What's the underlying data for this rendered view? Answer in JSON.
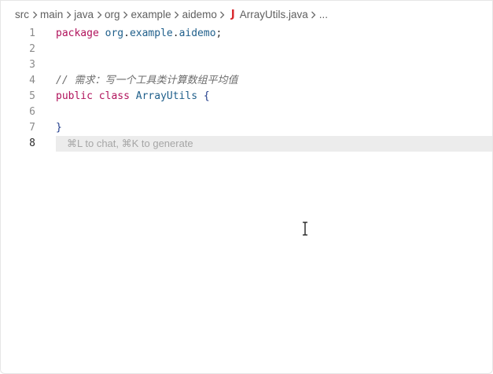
{
  "breadcrumb": {
    "items": [
      "src",
      "main",
      "java",
      "org",
      "example",
      "aidemo"
    ],
    "file_icon": "J",
    "file_name": "ArrayUtils.java",
    "more": "..."
  },
  "editor": {
    "lines": [
      {
        "number": "1",
        "parts": [
          {
            "t": "package",
            "c": "kw"
          },
          {
            "t": " ",
            "c": "punct"
          },
          {
            "t": "org",
            "c": "pkg"
          },
          {
            "t": ".",
            "c": "punct"
          },
          {
            "t": "example",
            "c": "pkg"
          },
          {
            "t": ".",
            "c": "punct"
          },
          {
            "t": "aidemo",
            "c": "pkg"
          },
          {
            "t": ";",
            "c": "punct"
          }
        ]
      },
      {
        "number": "2",
        "parts": []
      },
      {
        "number": "3",
        "parts": []
      },
      {
        "number": "4",
        "parts": [
          {
            "t": "// 需求：写一个工具类计算数组平均值",
            "c": "comment"
          }
        ]
      },
      {
        "number": "5",
        "parts": [
          {
            "t": "public",
            "c": "kw"
          },
          {
            "t": " ",
            "c": "punct"
          },
          {
            "t": "class",
            "c": "kw"
          },
          {
            "t": " ",
            "c": "punct"
          },
          {
            "t": "ArrayUtils",
            "c": "cls"
          },
          {
            "t": " ",
            "c": "punct"
          },
          {
            "t": "{",
            "c": "brace"
          }
        ]
      },
      {
        "number": "6",
        "parts": []
      },
      {
        "number": "7",
        "parts": [
          {
            "t": "}",
            "c": "brace"
          }
        ]
      },
      {
        "number": "8",
        "parts": []
      }
    ],
    "active_line": "8",
    "hint": "⌘L to chat, ⌘K to generate"
  },
  "icons": {
    "separator": "chevron-right-icon",
    "file": "java-file-icon",
    "cursor": "text-cursor-icon"
  },
  "colors": {
    "keyword": "#b1135c",
    "identifier": "#1f5f8b",
    "comment": "#6d6d6d",
    "java_icon": "#d8262b",
    "current_line": "#ececec"
  }
}
